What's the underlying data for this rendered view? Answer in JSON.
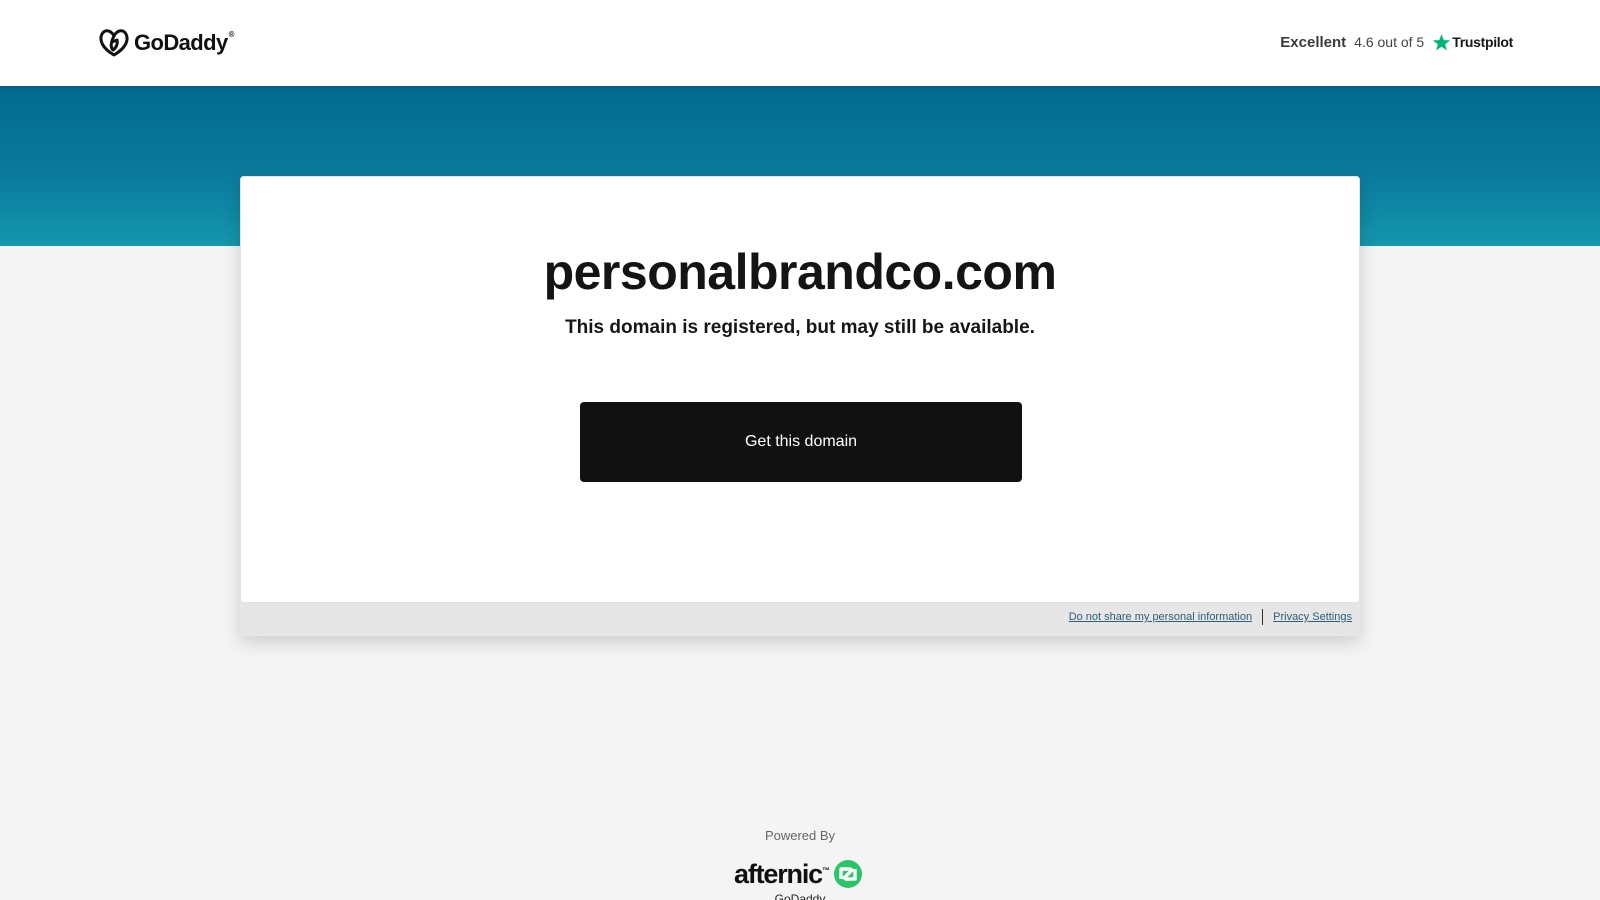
{
  "header": {
    "logo_text": "GoDaddy",
    "logo_tm": "®",
    "rating_label": "Excellent",
    "rating_score": "4.6 out of 5",
    "trustpilot_name": "Trustpilot",
    "trustpilot_star_color": "#00b67a"
  },
  "colors": {
    "hero_top": "#02698f",
    "hero_bottom": "#1597ac",
    "cta_bg": "#111111",
    "page_bg": "#f4f4f4",
    "link": "#2d5e7a",
    "afternic_green": "#2bc46a"
  },
  "main": {
    "domain": "personalbrandco.com",
    "subtitle": "This domain is registered, but may still be available.",
    "cta_label": "Get this domain"
  },
  "privacy": {
    "do_not_share": "Do not share my personal information",
    "settings": "Privacy Settings"
  },
  "footer": {
    "powered_by": "Powered By",
    "brand": "afternic",
    "brand_tm": "™",
    "cut_text": "GoDaddy"
  }
}
